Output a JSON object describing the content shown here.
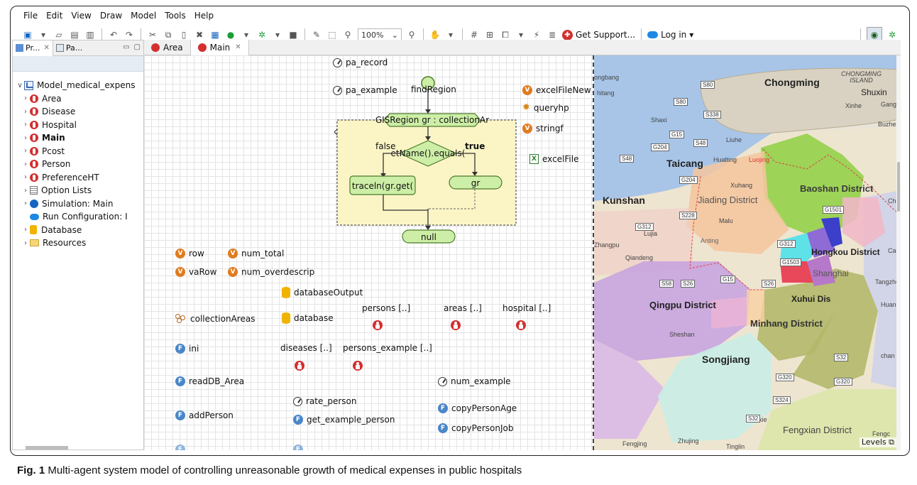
{
  "menu": [
    "File",
    "Edit",
    "View",
    "Draw",
    "Model",
    "Tools",
    "Help"
  ],
  "toolbar": {
    "zoom": "100%",
    "get_support": "Get Support...",
    "log_in": "Log in"
  },
  "left_panel": {
    "tab_projects": "Pr...",
    "tab_palette": "Pa...",
    "tree": [
      {
        "label": "Model_medical_expens",
        "type": "model",
        "arrow": "∨",
        "bold": false
      },
      {
        "label": "Area",
        "type": "agent",
        "arrow": "›",
        "bold": false
      },
      {
        "label": "Disease",
        "type": "agent",
        "arrow": "›",
        "bold": false
      },
      {
        "label": "Hospital",
        "type": "agent",
        "arrow": "›",
        "bold": false
      },
      {
        "label": "Main",
        "type": "agent",
        "arrow": "›",
        "bold": true
      },
      {
        "label": "Pcost",
        "type": "agent",
        "arrow": "›",
        "bold": false
      },
      {
        "label": "Person",
        "type": "agent",
        "arrow": "›",
        "bold": false
      },
      {
        "label": "PreferenceHT",
        "type": "agent",
        "arrow": "›",
        "bold": false
      },
      {
        "label": "Option Lists",
        "type": "list",
        "arrow": "›",
        "bold": false
      },
      {
        "label": "Simulation: Main",
        "type": "sim",
        "arrow": "›",
        "bold": false
      },
      {
        "label": "Run Configuration: I",
        "type": "run",
        "arrow": "",
        "bold": false
      },
      {
        "label": "Database",
        "type": "db",
        "arrow": "›",
        "bold": false
      },
      {
        "label": "Resources",
        "type": "folder",
        "arrow": "›",
        "bold": false
      }
    ]
  },
  "editor_tabs": {
    "area": "Area",
    "main": "Main"
  },
  "canvas": {
    "pa_record": "pa_record",
    "pa_example": "pa_example",
    "find_region": "findRegion",
    "excel_file_new": "excelFileNew",
    "queryhp": "queryhp",
    "stringf": "stringf",
    "excel_file": "excelFile",
    "loop_header": "GISRegion gr : collectionAr",
    "decision": "etName().equals(",
    "branch_false": "false",
    "branch_true": "true",
    "action_left": "traceln(gr.get(",
    "action_right": "gr",
    "end_null": "null",
    "row": "row",
    "num_total": "num_total",
    "va_row": "vaRow",
    "num_overdescrip": "num_overdescrip",
    "database_output": "databaseOutput",
    "collection_areas": "collectionAreas",
    "database": "database",
    "persons": "persons [..]",
    "areas": "areas [..]",
    "hospital": "hospital [..]",
    "ini": "ini",
    "diseases": "diseases [..]",
    "persons_example": "persons_example [..]",
    "read_db_area": "readDB_Area",
    "num_example": "num_example",
    "rate_person": "rate_person",
    "copy_person_age": "copyPersonAge",
    "add_person": "addPerson",
    "get_example_person": "get_example_person",
    "copy_person_job": "copyPersonJob"
  },
  "map": {
    "chongming": "Chongming",
    "chongming_island": "CHONGMING\nISLAND",
    "shuxin": "Shuxin",
    "xinhe": "Xinhe",
    "gangya": "Gangya",
    "buzhen": "Buzhen",
    "ongbang": "ongbang",
    "zhitang": "hitang",
    "shaxi": "Shaxi",
    "liuhe": "Liuhe",
    "taicang": "Taicang",
    "huating": "Hualting",
    "luojing": "Luojing",
    "xuhang": "Xuhang",
    "kunshan": "Kunshan",
    "jiading": "Jiading District",
    "baoshan": "Baoshan District",
    "cha": "Cha",
    "malu": "Malu",
    "lujia": "Lujia",
    "anting": "Anting",
    "zhangpu": "Zhangpu",
    "qiandeng": "Qiandeng",
    "hongkou": "Hongkou District",
    "caolu": "Caol",
    "shanghai": "Shanghai",
    "tangzhe": "Tangzhe",
    "qingpu": "Qingpu District",
    "xuhui": "Xuhui Dis",
    "huang": "Huang",
    "minhang": "Minhang District",
    "sheshan": "Sheshan",
    "songjiang": "Songjiang",
    "chan": "chan",
    "yexie": "Yexie",
    "fengxian": "Fengxian District",
    "fengc": "Fengc",
    "fengjing": "Fengjing",
    "zhujing": "Zhujing",
    "tinglin": "Tinglin",
    "levels": "Levels",
    "roads": [
      "S80",
      "S80",
      "S338",
      "G15",
      "S48",
      "G204",
      "S48",
      "G204",
      "G1501",
      "S228",
      "G312",
      "G312",
      "G1503",
      "S58",
      "S26",
      "G15",
      "S26",
      "S32",
      "G320",
      "G320",
      "S324",
      "S32"
    ]
  },
  "caption": {
    "label": "Fig. 1",
    "text": " Multi-agent system model of controlling unreasonable growth of medical expenses in public hospitals"
  }
}
